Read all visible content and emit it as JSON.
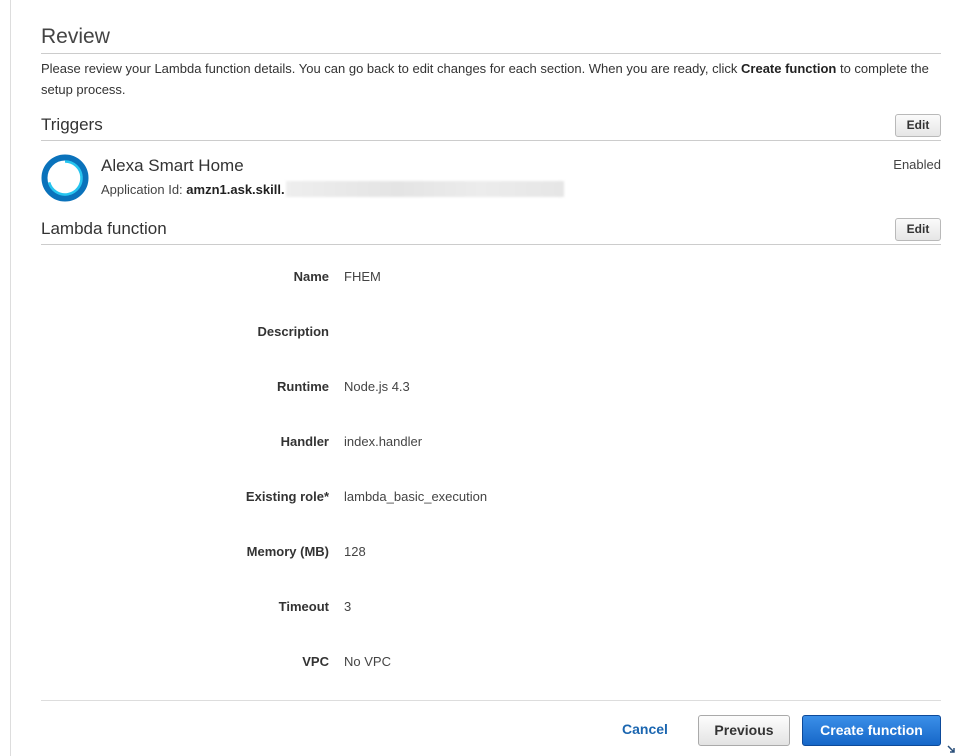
{
  "review": {
    "title": "Review",
    "intro_before": "Please review your Lambda function details. You can go back to edit changes for each section. When you are ready, click ",
    "intro_bold": "Create function",
    "intro_after": " to complete the setup process."
  },
  "triggers": {
    "title": "Triggers",
    "edit_label": "Edit",
    "item": {
      "name": "Alexa Smart Home",
      "app_id_label": "Application Id: ",
      "app_id_value": "amzn1.ask.skill.",
      "status": "Enabled",
      "icon": "alexa-ring-icon",
      "icon_colors": {
        "outer": "#0a72bb",
        "inner": "#26c4ef"
      }
    }
  },
  "lambda": {
    "title": "Lambda function",
    "edit_label": "Edit",
    "fields": [
      {
        "label": "Name",
        "value": "FHEM"
      },
      {
        "label": "Description",
        "value": ""
      },
      {
        "label": "Runtime",
        "value": "Node.js 4.3"
      },
      {
        "label": "Handler",
        "value": "index.handler"
      },
      {
        "label": "Existing role*",
        "value": "lambda_basic_execution"
      },
      {
        "label": "Memory (MB)",
        "value": "128"
      },
      {
        "label": "Timeout",
        "value": "3"
      },
      {
        "label": "VPC",
        "value": "No VPC"
      }
    ]
  },
  "footer": {
    "cancel_label": "Cancel",
    "previous_label": "Previous",
    "create_label": "Create function"
  },
  "colors": {
    "link": "#1b66b0",
    "primary_button": "#1a6fd0"
  }
}
